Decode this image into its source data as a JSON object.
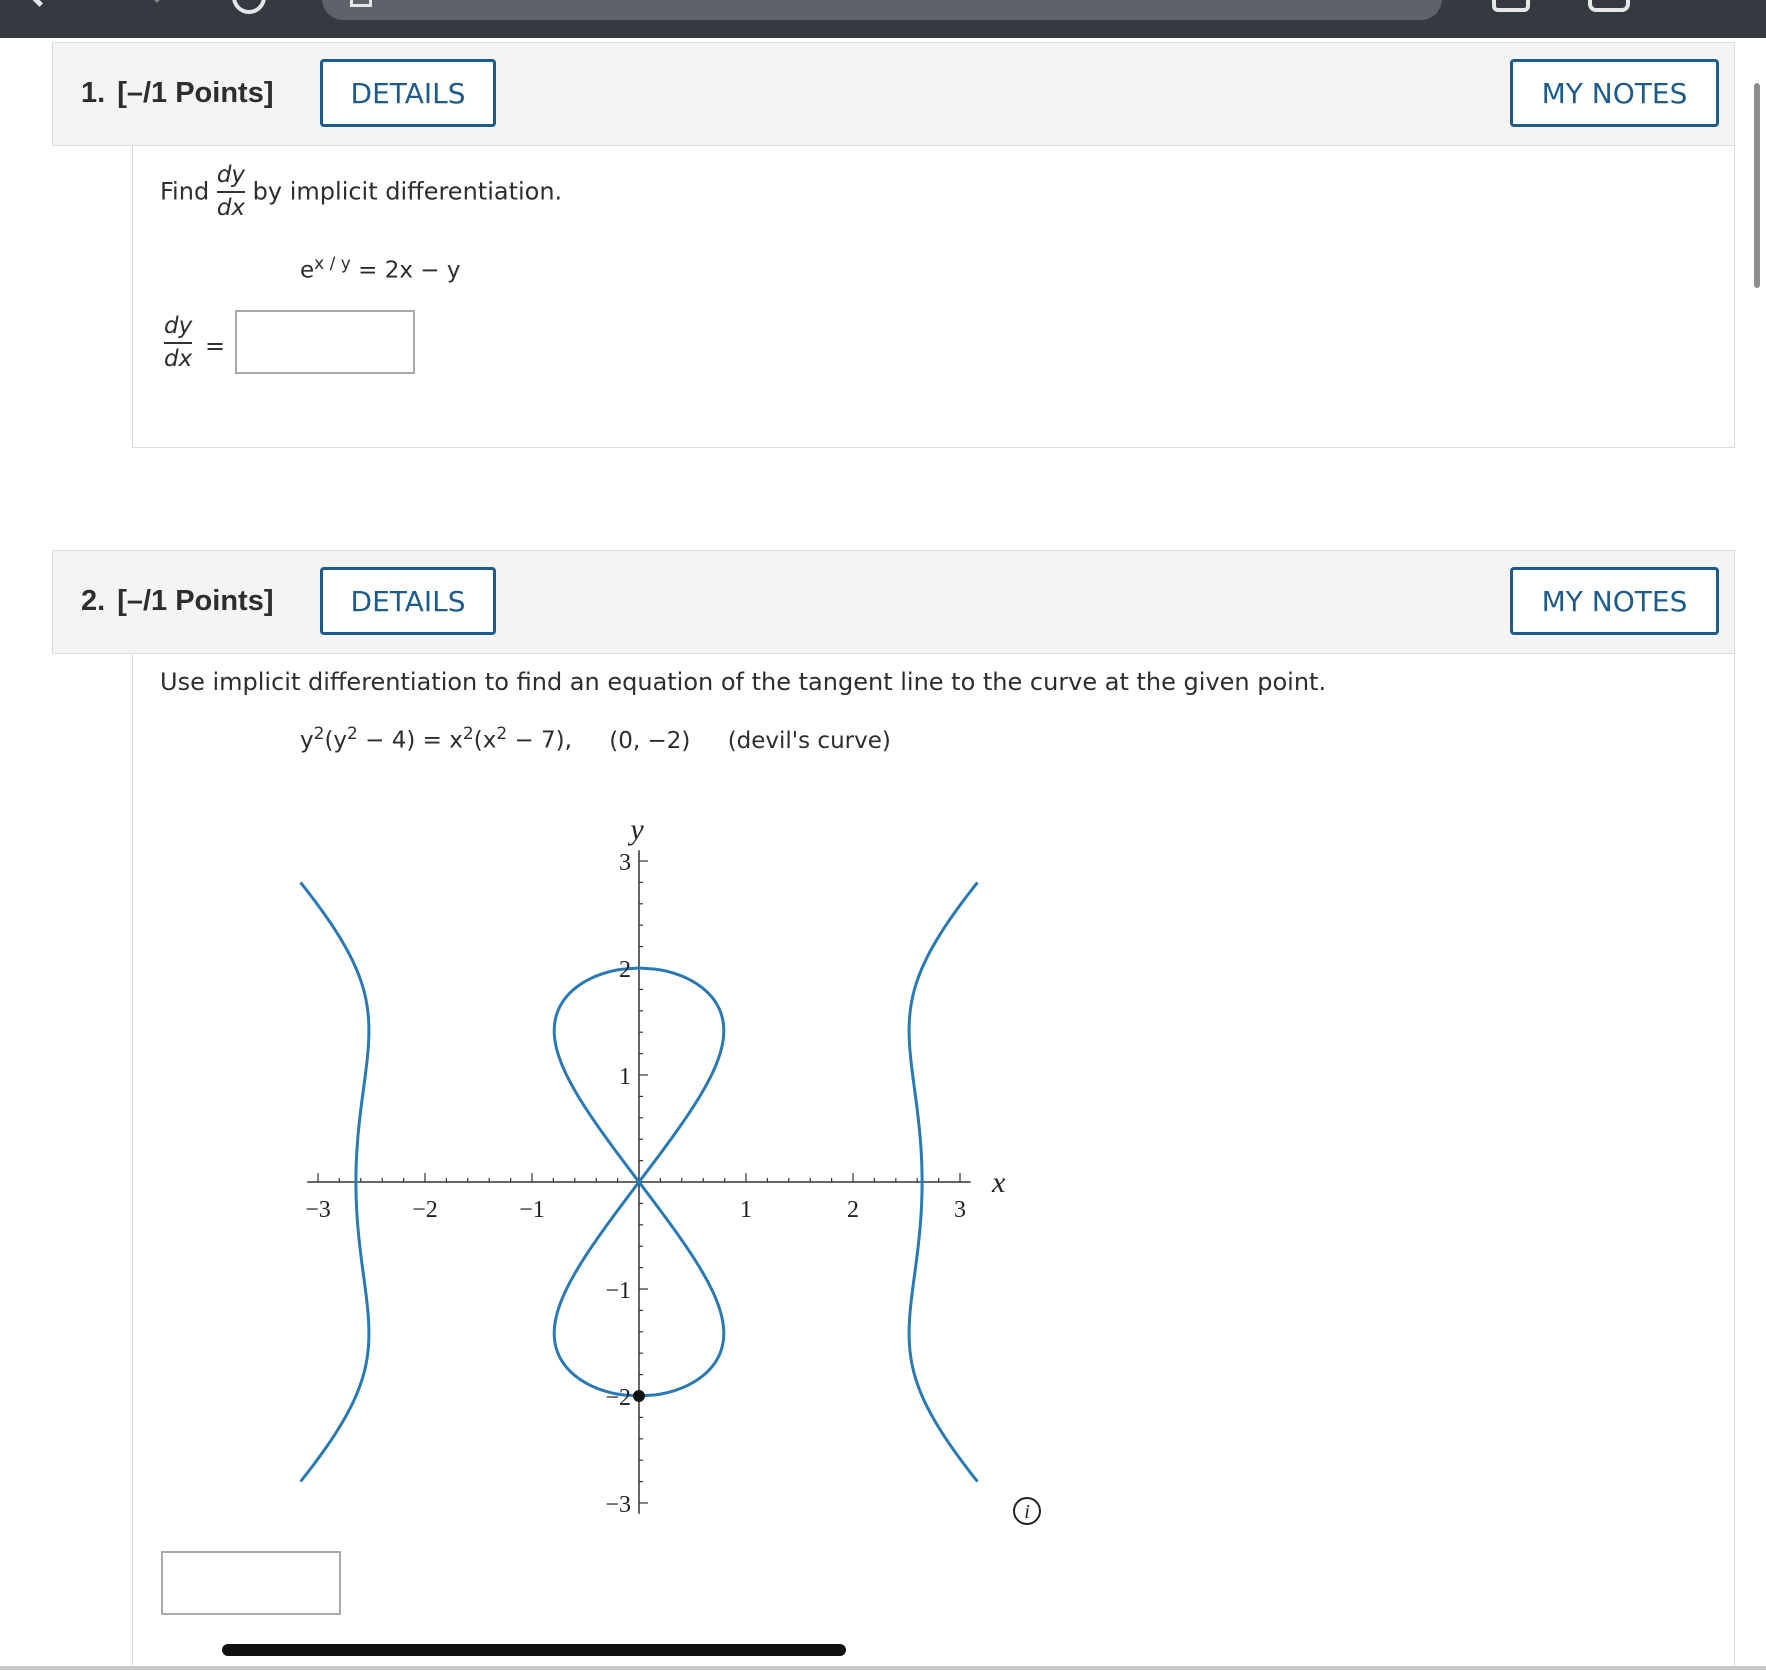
{
  "questions": [
    {
      "number": "1.",
      "points": "[–/1 Points]",
      "details_label": "DETAILS",
      "notes_label": "MY NOTES",
      "prompt_before": "Find",
      "prompt_frac_num": "dy",
      "prompt_frac_den": "dx",
      "prompt_after": "by implicit differentiation.",
      "equation_base": "e",
      "equation_exp": "x / y",
      "equation_rest": " = 2x − y",
      "answer_frac_num": "dy",
      "answer_frac_den": "dx",
      "answer_equals": "=",
      "answer_value": ""
    },
    {
      "number": "2.",
      "points": "[–/1 Points]",
      "details_label": "DETAILS",
      "notes_label": "MY NOTES",
      "prompt": "Use implicit differentiation to find an equation of the tangent line to the curve at the given point.",
      "equation": {
        "p1": "y",
        "s1": "2",
        "p2": "(y",
        "s2": "2",
        "p3": " − 4) = x",
        "s3": "2",
        "p4": "(x",
        "s4": "2",
        "p5": " − 7),",
        "point": "(0, −2)",
        "name": "(devil's curve)"
      },
      "answer_value": "",
      "info_icon": "info-icon"
    }
  ],
  "chart_data": {
    "type": "line",
    "title": "",
    "xlabel": "x",
    "ylabel": "y",
    "xlim": [
      -3,
      3
    ],
    "ylim": [
      -3,
      3
    ],
    "x_ticks": [
      "−3",
      "−2",
      "−1",
      "1",
      "2",
      "3"
    ],
    "y_ticks": [
      "3",
      "2",
      "1",
      "−1",
      "−2",
      "−3"
    ],
    "curve_equation": "y^2(y^2 - 4) = x^2(x^2 - 7)",
    "series": [
      {
        "values": [
          {
            "x": 0,
            "y": 0
          },
          {
            "x": 0.5,
            "y": 0.93
          },
          {
            "x": 0.72,
            "y": 1.5
          },
          {
            "x": 0.65,
            "y": 1.85
          },
          {
            "x": 0.5,
            "y": 1.95
          },
          {
            "x": 0,
            "y": 2
          }
        ]
      },
      {
        "values": [
          {
            "x": 3.11,
            "y": 2.8
          },
          {
            "x": 2.62,
            "y": 1.5
          },
          {
            "x": 2.6,
            "y": 0
          },
          {
            "x": 2.62,
            "y": -1.5
          },
          {
            "x": 3.11,
            "y": -2.8
          }
        ]
      }
    ],
    "highlight_point": {
      "x": 0,
      "y": -2
    },
    "line_color": "#2a78b4",
    "point_color": "#111111"
  }
}
